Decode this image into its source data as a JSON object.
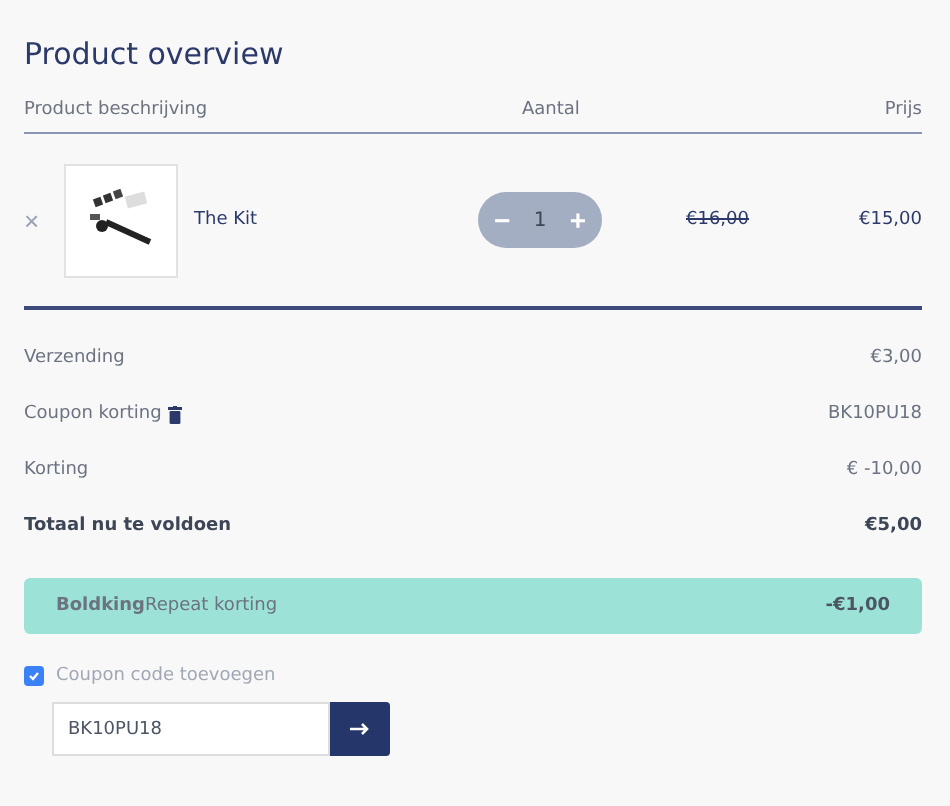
{
  "title": "Product overview",
  "columns": [
    "Product beschrijving",
    "Aantal",
    "Prijs"
  ],
  "product": {
    "remove": "×",
    "name": "The Kit",
    "quantity": {
      "minus": "−",
      "value": "1",
      "plus": "+"
    },
    "old_price": "€16,00",
    "price": "€15,00"
  },
  "summary": [
    {
      "kind": "plain",
      "label": "Verzending",
      "value": "€3,00"
    },
    {
      "kind": "coupon",
      "label": "Coupon korting",
      "value": "BK10PU18"
    },
    {
      "kind": "plain",
      "label": "Korting",
      "value": "€ -10,00"
    },
    {
      "kind": "total",
      "label": "Totaal nu te voldoen",
      "value": "€5,00"
    }
  ],
  "banner": {
    "label": "**Boldking**Repeat korting",
    "value": "-€1,00"
  },
  "coupon": {
    "checked": true,
    "label": "Coupon code toevoegen",
    "value": "BK10PU18"
  }
}
